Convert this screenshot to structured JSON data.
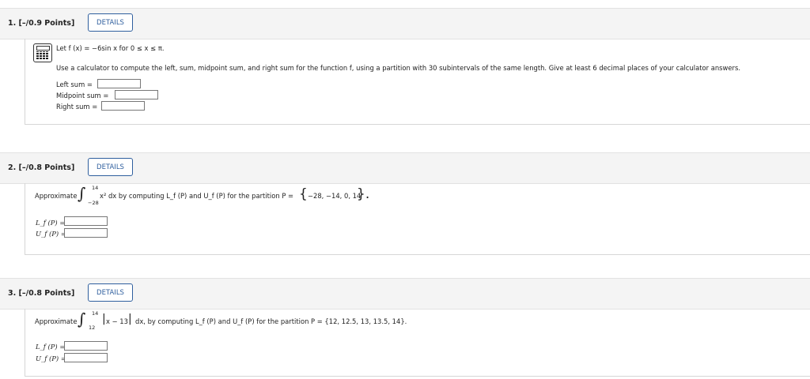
{
  "problems": [
    {
      "number": "1.",
      "points": "[–/0.9 Points]",
      "details_label": "DETAILS",
      "prompt_line1": "Let f (x) = −6sin x for 0 ≤ x ≤ π.",
      "prompt_line2": "Use a calculator to compute the left, sum, midpoint sum, and right sum for the function f, using a partition with 30 subintervals of the same length. Give at least 6 decimal places of your calculator answers.",
      "fields": [
        {
          "label": "Left sum =",
          "value": ""
        },
        {
          "label": "Midpoint sum =",
          "value": ""
        },
        {
          "label": "Right sum =",
          "value": ""
        }
      ]
    },
    {
      "number": "2.",
      "points": "[–/0.8 Points]",
      "details_label": "DETAILS",
      "approx": "Approximate",
      "upper": "14",
      "lower": "−28",
      "integrand": "x² dx by computing L_f (P) and U_f (P) for the partition P =",
      "partition": "−28, −14, 0, 14",
      "fields": [
        {
          "label": "L_f (P) =",
          "value": ""
        },
        {
          "label": "U_f (P) =",
          "value": ""
        }
      ]
    },
    {
      "number": "3.",
      "points": "[–/0.8 Points]",
      "details_label": "DETAILS",
      "approx": "Approximate",
      "upper": "14",
      "lower": "12",
      "abs_inner": "x − 13",
      "rest": "dx, by computing L_f (P) and U_f (P) for the partition P = {12, 12.5, 13, 13.5, 14}.",
      "fields": [
        {
          "label": "L_f (P) =",
          "value": ""
        },
        {
          "label": "U_f (P) =",
          "value": ""
        }
      ]
    }
  ]
}
